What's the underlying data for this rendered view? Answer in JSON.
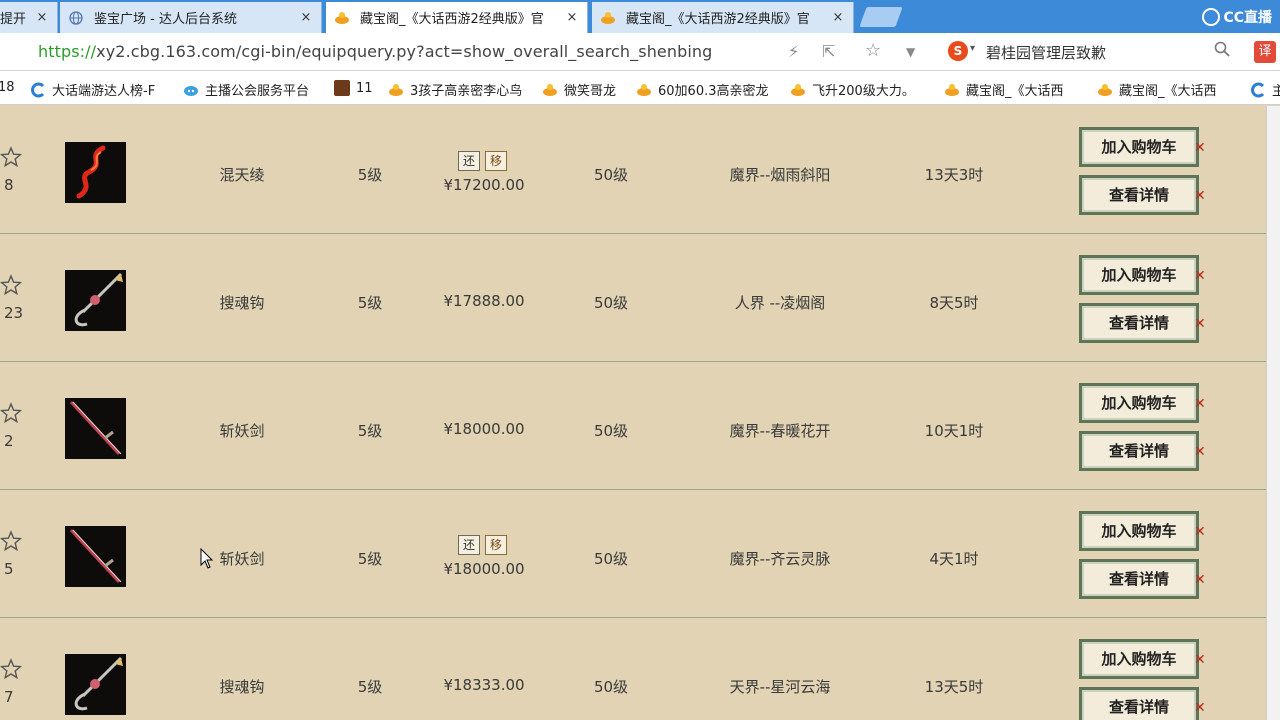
{
  "browser": {
    "tabs": [
      {
        "title": "提开",
        "icon": "page-icon"
      },
      {
        "title": "鉴宝广场 - 达人后台系统",
        "icon": "globe-icon"
      },
      {
        "title": "藏宝阁_《大话西游2经典版》官",
        "icon": "cbg-icon"
      },
      {
        "title": "藏宝阁_《大话西游2经典版》官",
        "icon": "cbg-icon"
      }
    ],
    "close_glyph": "×",
    "brand_label": "CC直播",
    "url": {
      "proto": "https://",
      "rest": "xy2.cbg.163.com/cgi-bin/equipquery.py?act=show_overall_search_shenbing"
    },
    "search_engine_label": "S",
    "search_text": "碧桂园管理层致歉",
    "translate_label": "译",
    "bookmarks": [
      {
        "label": "18",
        "icon": "folder-icon"
      },
      {
        "label": "大话端游达人榜-F",
        "icon": "c-icon"
      },
      {
        "label": "主播公会服务平台",
        "icon": "cloud-icon"
      },
      {
        "label": "11",
        "icon": "game-icon"
      },
      {
        "label": "3孩子高亲密李心鸟",
        "icon": "cbg-icon"
      },
      {
        "label": "微笑哥龙",
        "icon": "cbg-icon"
      },
      {
        "label": "60加60.3高亲密龙",
        "icon": "cbg-icon"
      },
      {
        "label": "飞升200级大力。",
        "icon": "cbg-icon"
      },
      {
        "label": "藏宝阁_《大话西",
        "icon": "cbg-icon"
      },
      {
        "label": "藏宝阁_《大话西",
        "icon": "cbg-icon"
      },
      {
        "label": "主",
        "icon": "c-icon"
      }
    ]
  },
  "listing": {
    "rows": [
      {
        "favorites": "8",
        "name": "混天绫",
        "level": "5级",
        "has_badges": true,
        "price": "¥17200.00",
        "req_level": "50级",
        "server": "魔界--烟雨斜阳",
        "time_left": "13天3时",
        "item": "ribbon"
      },
      {
        "favorites": "23",
        "name": "搜魂钩",
        "level": "5级",
        "has_badges": false,
        "price": "¥17888.00",
        "req_level": "50级",
        "server": "人界 --凌烟阁",
        "time_left": "8天5时",
        "item": "hook"
      },
      {
        "favorites": "2",
        "name": "斩妖剑",
        "level": "5级",
        "has_badges": false,
        "price": "¥18000.00",
        "req_level": "50级",
        "server": "魔界--春暖花开",
        "time_left": "10天1时",
        "item": "sword"
      },
      {
        "favorites": "5",
        "name": "斩妖剑",
        "level": "5级",
        "has_badges": true,
        "price": "¥18000.00",
        "req_level": "50级",
        "server": "魔界--齐云灵脉",
        "time_left": "4天1时",
        "item": "sword"
      },
      {
        "favorites": "7",
        "name": "搜魂钩",
        "level": "5级",
        "has_badges": false,
        "price": "¥18333.00",
        "req_level": "50级",
        "server": "天界--星河云海",
        "time_left": "13天5时",
        "item": "hook"
      }
    ],
    "badge_return": "还",
    "badge_move": "移",
    "add_cart_label": "加入购物车",
    "details_label": "查看详情"
  }
}
